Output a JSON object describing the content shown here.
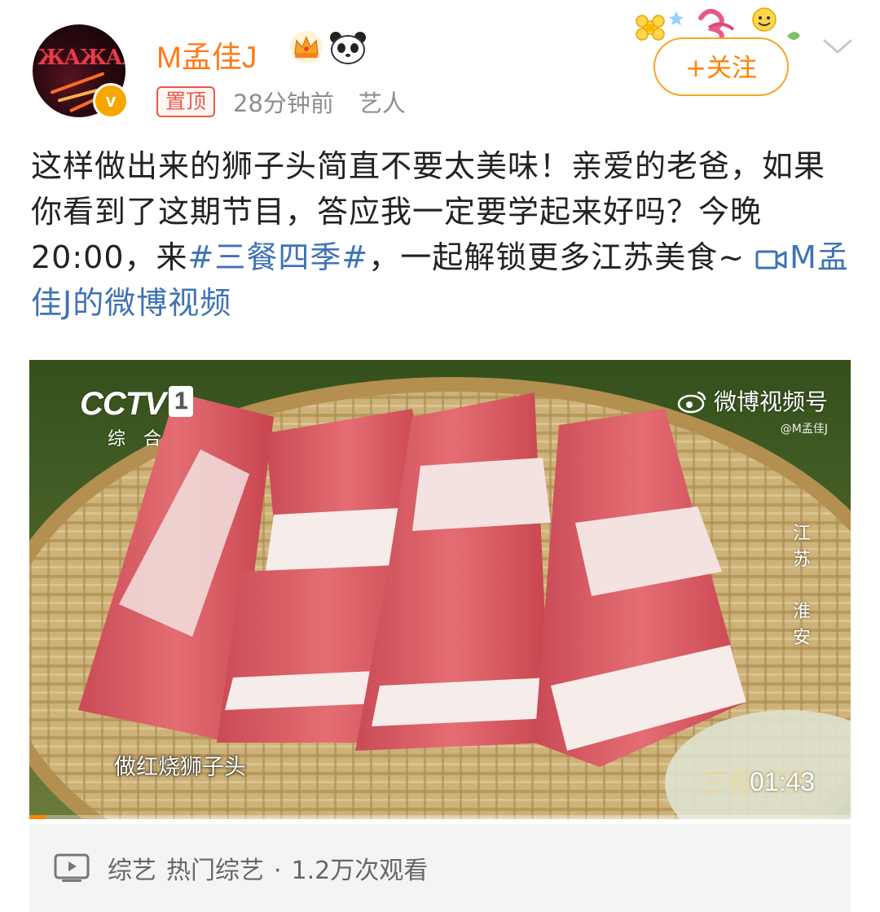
{
  "header": {
    "username": "M孟佳J",
    "pin_tag": "置顶",
    "time": "28分钟前",
    "source": "艺人",
    "follow_label": "+关注",
    "avatar_text": "ЖАЖАЖ",
    "verified_badge": "v"
  },
  "post": {
    "text_before": "这样做出来的狮子头简直不要太美味！亲爱的老爸，如果你看到了这期节目，答应我一定要学起来好吗？今晚20:00，来",
    "hashtag": "#三餐四季#",
    "text_after": "，一起解锁更多江苏美食~ ",
    "video_link": "M孟佳J的微博视频"
  },
  "video": {
    "channel_logo": "CCTV",
    "channel_num": "1",
    "channel_sub": "综合",
    "watermark_title": "微博视频号",
    "watermark_sub": "@M孟佳J",
    "location_vertical": "江苏 淮安",
    "subtitle": "做红烧狮子头",
    "show_watermark": "三餐四季",
    "duration": "01:43",
    "progress_fraction": 0.02
  },
  "footer": {
    "category": "综艺",
    "subcategory": "热门综艺",
    "separator": "·",
    "views": "1.2万次观看"
  },
  "colors": {
    "username": "#ff7a1a",
    "link": "#3f73b4",
    "follow_border": "#f5a623",
    "pin_tag": "#e85a4a",
    "meta_gray": "#8e8e8e"
  },
  "icons": [
    "crown-icon",
    "panda-icon",
    "chevron-down-icon",
    "video-link-icon",
    "weibo-icon",
    "video-icon",
    "verified-badge-icon"
  ]
}
